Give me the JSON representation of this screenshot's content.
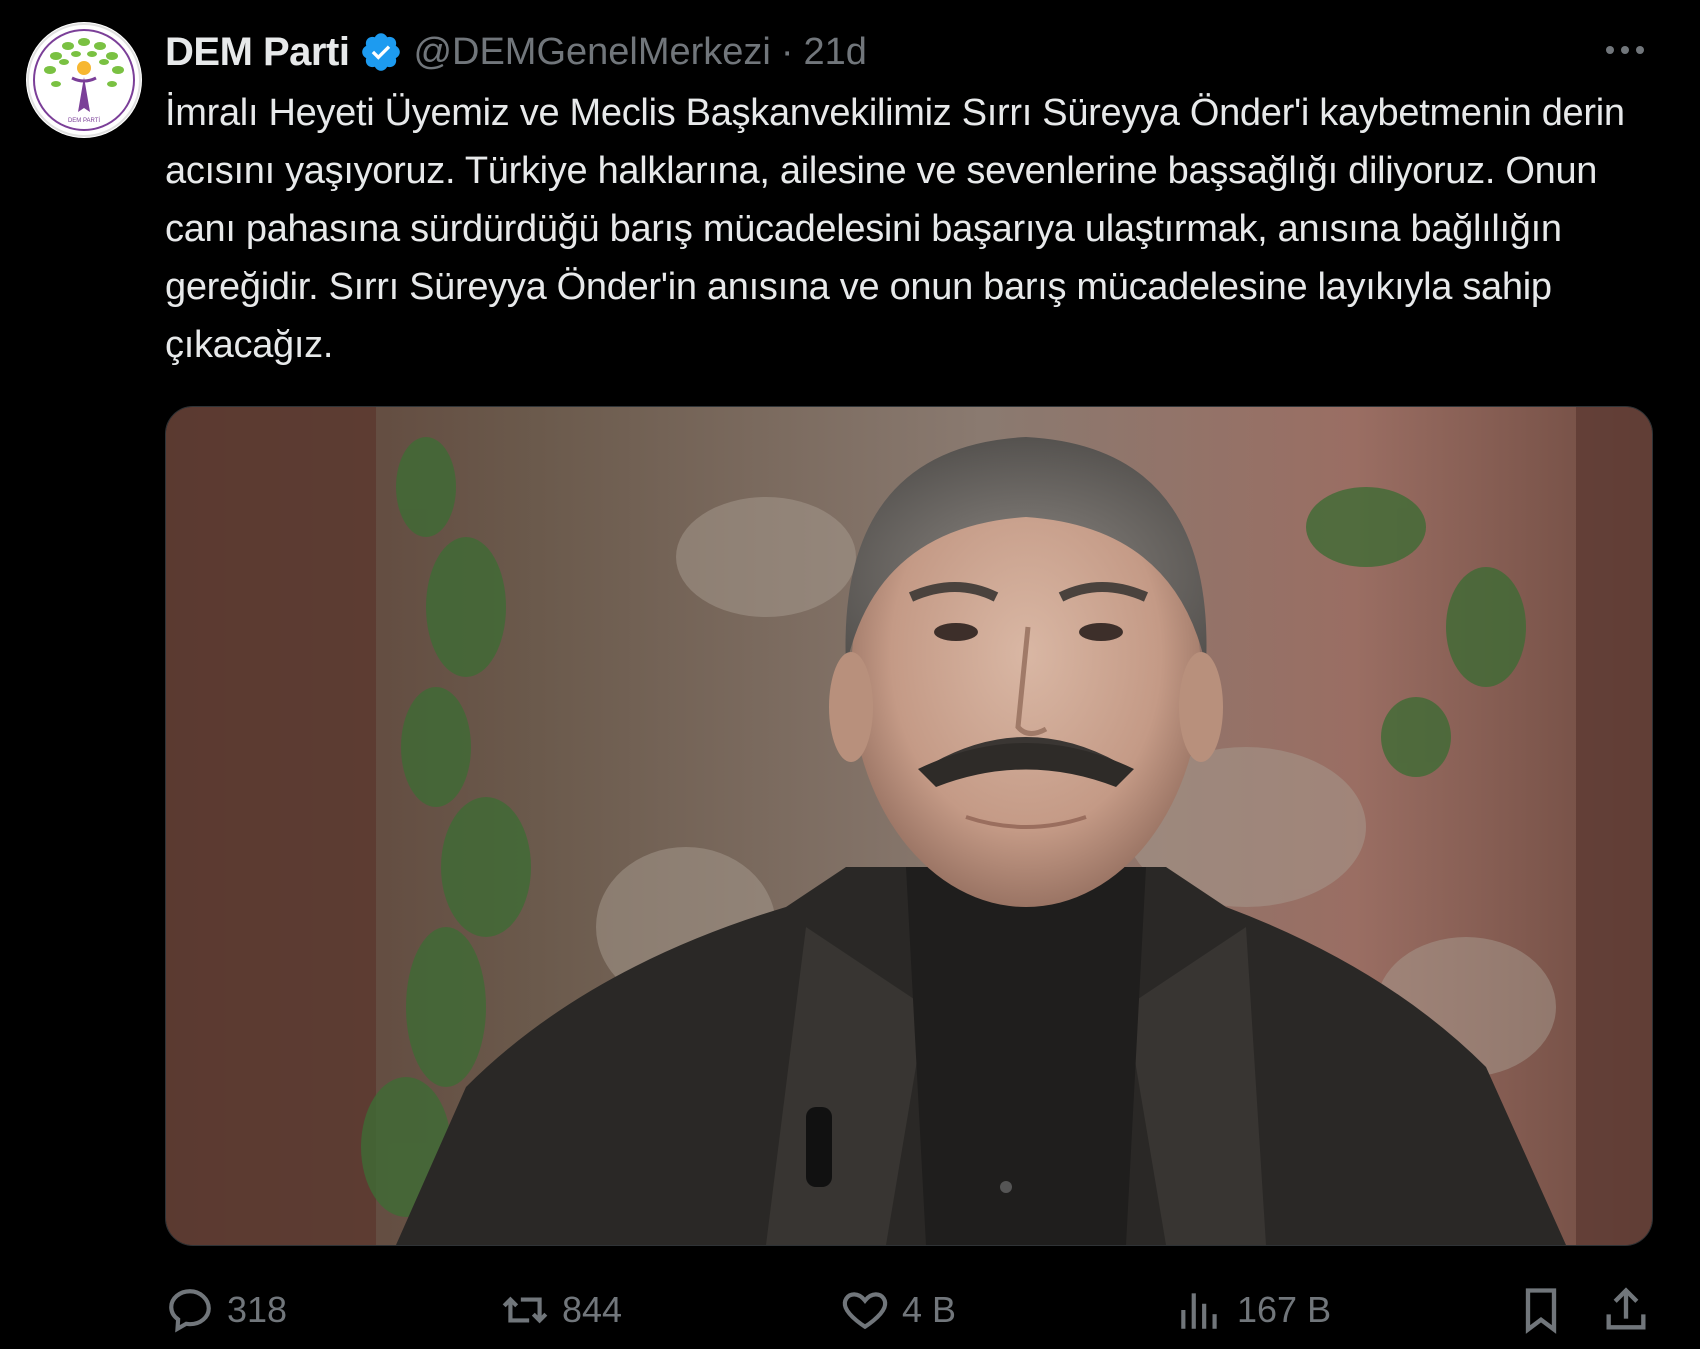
{
  "author": {
    "display_name": "DEM Parti",
    "handle": "@DEMGenelMerkezi",
    "separator": "·",
    "time": "21d",
    "avatar_icon": "dem-parti-logo",
    "avatar_logo_text": "DEM PARTİ",
    "verified_icon": "verified-badge-icon",
    "verified_color": "#1d9bf0"
  },
  "tweet": {
    "text": "İmralı Heyeti Üyemiz ve Meclis Başkanvekilimiz Sırrı Süreyya Önder'i kaybetmenin derin acısını yaşıyoruz. Türkiye halklarına, ailesine ve sevenlerine başsağlığı diliyoruz. Onun canı pahasına sürdürdüğü barış mücadelesini başarıya ulaştırmak, anısına bağlılığın gereğidir. Sırrı Süreyya Önder'in anısına ve onun barış mücadelesine layıkıyla sahip çıkacağız."
  },
  "actions": {
    "replies": "318",
    "reposts": "844",
    "likes": "4 B",
    "views": "167 B",
    "reply_icon": "reply-icon",
    "repost_icon": "repost-icon",
    "like_icon": "heart-icon",
    "views_icon": "views-chart-icon",
    "bookmark_icon": "bookmark-icon",
    "share_icon": "share-icon"
  },
  "colors": {
    "background": "#000000",
    "text_primary": "#e7e9ea",
    "text_secondary": "#71767b",
    "logo_green": "#7ac142",
    "logo_purple": "#7b3f98"
  }
}
